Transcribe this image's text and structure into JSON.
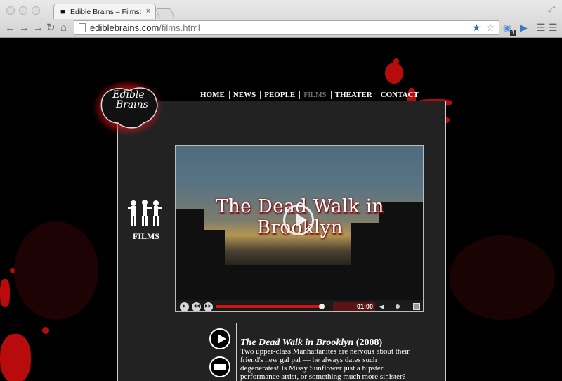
{
  "browser": {
    "tab_title": "Edible Brains – Films: Dead",
    "tab_close": "×",
    "url_host": "ediblebrains.com",
    "url_path": "/films.html",
    "extension_badge": "1"
  },
  "site": {
    "logo_text_line1": "Edible",
    "logo_text_line2": "Brains",
    "accent_color": "#b80c0c",
    "nav": [
      {
        "label": "HOME"
      },
      {
        "label": "NEWS"
      },
      {
        "label": "PEOPLE"
      },
      {
        "label": "FILMS",
        "active": true
      },
      {
        "label": "THEATER"
      },
      {
        "label": "CONTACT"
      }
    ],
    "section_label": "FILMS"
  },
  "video": {
    "title_overlay": "The Dead Walk in Brooklyn",
    "time": "01:00",
    "progress": 1.0
  },
  "film": {
    "title": "The Dead Walk in Brooklyn",
    "year": "(2008)",
    "description": "Two upper-class Manhattanites are nervous about their friend's new gal pal — he always dates such degenerates! Is Missy Sunflower just a hipster performance artist, or something much more sinister?"
  }
}
